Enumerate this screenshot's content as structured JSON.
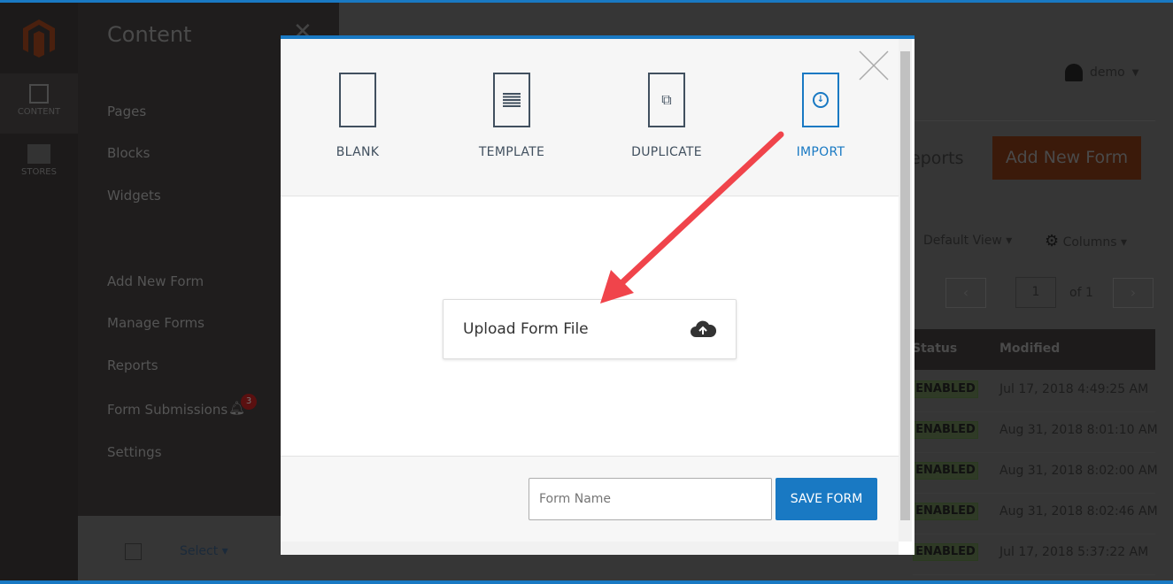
{
  "sidebar": {
    "items": [
      {
        "label": "CONTENT",
        "icon": "layout-icon"
      },
      {
        "label": "STORES",
        "icon": "store-icon"
      }
    ]
  },
  "panel": {
    "title": "Content",
    "links": [
      "Pages",
      "Blocks",
      "Widgets",
      "Add New Form",
      "Manage Forms",
      "Reports",
      "Form Submissions",
      "Settings"
    ],
    "badge_count": "3"
  },
  "header": {
    "user": "demo",
    "page_title_partial": "eports",
    "add_button": "Add New Form"
  },
  "grid": {
    "view": "Default View",
    "columns": "Columns",
    "page": "1",
    "of": "of 1",
    "headers": [
      "Status",
      "Modified"
    ],
    "rows": [
      {
        "status": "ENABLED",
        "modified": "Jul 17, 2018 4:49:25 AM"
      },
      {
        "status": "ENABLED",
        "modified": "Aug 31, 2018 8:01:10 AM"
      },
      {
        "status": "ENABLED",
        "modified": "Aug 31, 2018 8:02:00 AM"
      },
      {
        "status": "ENABLED",
        "modified": "Aug 31, 2018 8:02:46 AM"
      },
      {
        "status": "ENABLED",
        "modified": "Jul 17, 2018 5:37:22 AM"
      }
    ],
    "select_label": "Select"
  },
  "modal": {
    "options": [
      {
        "label": "BLANK",
        "active": false
      },
      {
        "label": "TEMPLATE",
        "active": false
      },
      {
        "label": "DUPLICATE",
        "active": false
      },
      {
        "label": "IMPORT",
        "active": true
      }
    ],
    "upload_label": "Upload Form File",
    "form_name_placeholder": "Form Name",
    "save_label": "SAVE FORM"
  },
  "colors": {
    "accent": "#1979c3",
    "arrow": "#f0444b",
    "brand": "#eb5202"
  }
}
